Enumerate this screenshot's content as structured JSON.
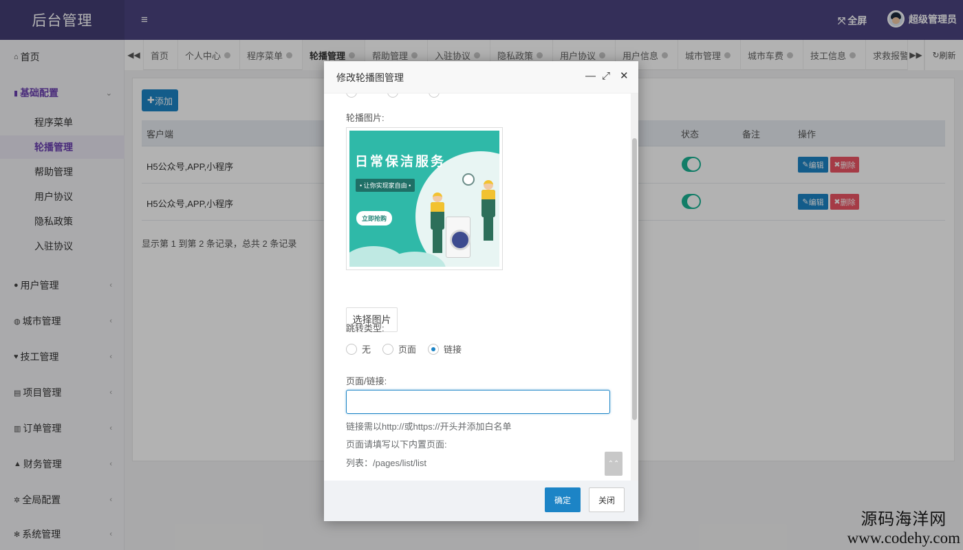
{
  "header": {
    "brand": "后台管理",
    "menu_icon": "hamburger-icon",
    "fullscreen_label": "全屏",
    "user_name": "超级管理员"
  },
  "sidebar": {
    "items": [
      {
        "label": "首页",
        "icon": "home-icon"
      },
      {
        "label": "基础配置",
        "icon": "bookmark-icon",
        "open": true
      },
      {
        "label": "用户管理",
        "icon": "user-icon"
      },
      {
        "label": "城市管理",
        "icon": "globe-icon"
      },
      {
        "label": "技工管理",
        "icon": "heart-icon"
      },
      {
        "label": "项目管理",
        "icon": "book-icon"
      },
      {
        "label": "订单管理",
        "icon": "bar-chart-icon"
      },
      {
        "label": "财务管理",
        "icon": "area-chart-icon"
      },
      {
        "label": "全局配置",
        "icon": "cogs-icon"
      },
      {
        "label": "系统管理",
        "icon": "gear-icon"
      }
    ],
    "sub_items": [
      "程序菜单",
      "轮播管理",
      "帮助管理",
      "用户协议",
      "隐私政策",
      "入驻协议"
    ],
    "active_sub": "轮播管理"
  },
  "tabs": {
    "items": [
      "首页",
      "个人中心",
      "程序菜单",
      "轮播管理",
      "帮助管理",
      "入驻协议",
      "隐私政策",
      "用户协议",
      "用户信息",
      "城市管理",
      "城市车费",
      "技工信息",
      "求救报警"
    ],
    "active": "轮播管理",
    "refresh_label": "刷新"
  },
  "toolbar": {
    "add_label": "添加"
  },
  "table": {
    "headers": {
      "client": "客户端",
      "status": "状态",
      "remark": "备注",
      "actions": "操作"
    },
    "rows": [
      {
        "client": "H5公众号,APP,小程序",
        "status_on": true,
        "remark": ""
      },
      {
        "client": "H5公众号,APP,小程序",
        "status_on": true,
        "remark": ""
      }
    ],
    "edit_label": "编辑",
    "delete_label": "删除",
    "pager": "显示第 1 到第 2 条记录，总共 2 条记录"
  },
  "dialog": {
    "title": "修改轮播图管理",
    "image_label": "轮播图片:",
    "banner": {
      "title": "日常保洁服务",
      "subtitle": "• 让你实现家自由 •",
      "button": "立即抢购"
    },
    "choose_image_label": "选择图片",
    "jump_type_label": "跳转类型:",
    "jump_options": [
      "无",
      "页面",
      "链接"
    ],
    "jump_selected": "链接",
    "link_label": "页面/链接:",
    "link_value": "",
    "hints": [
      "链接需以http://或https://开头并添加白名单",
      "页面请填写以下内置页面:",
      "列表：/pages/list/list"
    ],
    "ok_label": "确定",
    "close_label": "关闭"
  },
  "watermark": {
    "cn": "源码海洋网",
    "en": "www.codehy.com"
  }
}
